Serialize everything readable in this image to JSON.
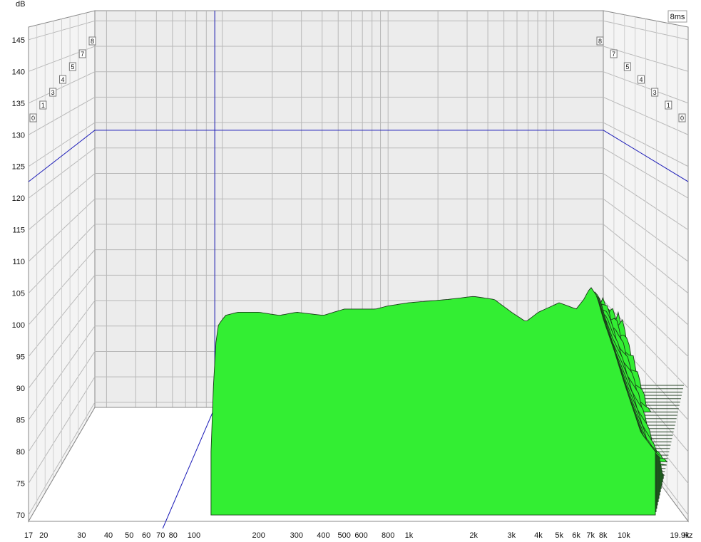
{
  "chart_data": {
    "type": "area",
    "ylabel": "dB",
    "xunit": "Hz",
    "time_window_label": "8ms",
    "ylim": [
      69,
      147
    ],
    "yticks": [
      70,
      75,
      80,
      85,
      90,
      95,
      100,
      105,
      110,
      115,
      120,
      125,
      130,
      135,
      140,
      145
    ],
    "xlim": [
      17,
      19900
    ],
    "xscale": "log",
    "xticks": [
      {
        "v": 17,
        "label": "17"
      },
      {
        "v": 20,
        "label": "20"
      },
      {
        "v": 30,
        "label": "30"
      },
      {
        "v": 40,
        "label": "40"
      },
      {
        "v": 50,
        "label": "50"
      },
      {
        "v": 60,
        "label": "60"
      },
      {
        "v": 70,
        "label": "70"
      },
      {
        "v": 80,
        "label": "80"
      },
      {
        "v": 100,
        "label": "100"
      },
      {
        "v": 200,
        "label": "200"
      },
      {
        "v": 300,
        "label": "300"
      },
      {
        "v": 400,
        "label": "400"
      },
      {
        "v": 500,
        "label": "500"
      },
      {
        "v": 600,
        "label": "600"
      },
      {
        "v": 800,
        "label": "800"
      },
      {
        "v": 1000,
        "label": "1k"
      },
      {
        "v": 2000,
        "label": "2k"
      },
      {
        "v": 3000,
        "label": "3k"
      },
      {
        "v": 4000,
        "label": "4k"
      },
      {
        "v": 5000,
        "label": "5k"
      },
      {
        "v": 6000,
        "label": "6k"
      },
      {
        "v": 7000,
        "label": "7k"
      },
      {
        "v": 8000,
        "label": "8k"
      },
      {
        "v": 10000,
        "label": "10k"
      },
      {
        "v": 19900,
        "label": "19.9k"
      }
    ],
    "time_slices_ms": [
      "0",
      "1",
      "3",
      "4",
      "5",
      "7",
      "8"
    ],
    "cursor": {
      "freq_hz": 90,
      "level_db": 123.5
    },
    "floor_db": 80,
    "front_response": {
      "freq": [
        120,
        125,
        130,
        140,
        160,
        200,
        250,
        300,
        400,
        500,
        600,
        700,
        800,
        1000,
        1500,
        2000,
        2500,
        3000,
        3500,
        4000,
        5000,
        6000,
        6500,
        7000,
        7500,
        8000,
        9000,
        10000,
        12000,
        14000
      ],
      "db": [
        80,
        96,
        100,
        101.5,
        102,
        102,
        101.5,
        102,
        101.5,
        102.5,
        102.5,
        102.5,
        103,
        103.5,
        104,
        104.5,
        104,
        102,
        100.5,
        102,
        103.5,
        102.5,
        104,
        106,
        104.5,
        101,
        96,
        91,
        83,
        80
      ]
    },
    "series": [
      {
        "name": "green",
        "color": "#33ee33"
      }
    ],
    "colors": {
      "fill": "#33ee33",
      "outline": "#1a3a1a",
      "cursor": "#1a1ab8",
      "grid": "#b8b8b8",
      "wall": "#ececec"
    }
  }
}
